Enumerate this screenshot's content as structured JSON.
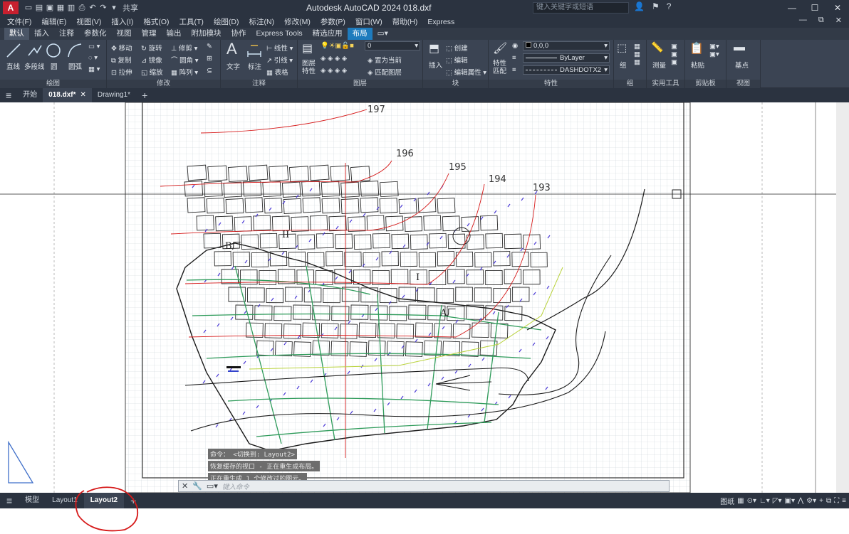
{
  "titlebar": {
    "logo": "A",
    "share": "共享",
    "app_title": "Autodesk AutoCAD 2024    018.dxf",
    "search_placeholder": "键入关键字或短语",
    "window_buttons": [
      "—",
      "☐",
      "✕"
    ]
  },
  "menubar": {
    "items": [
      "文件(F)",
      "编辑(E)",
      "视图(V)",
      "插入(I)",
      "格式(O)",
      "工具(T)",
      "绘图(D)",
      "标注(N)",
      "修改(M)",
      "参数(P)",
      "窗口(W)",
      "帮助(H)",
      "Express"
    ],
    "right_controls": [
      "—",
      "⧉",
      "✕"
    ]
  },
  "ribbon_tabs": {
    "items": [
      "默认",
      "插入",
      "注释",
      "参数化",
      "视图",
      "管理",
      "输出",
      "附加模块",
      "协作",
      "Express Tools",
      "精选应用",
      "布局"
    ],
    "active": "默认",
    "highlight": "布局"
  },
  "ribbon": {
    "draw": {
      "title": "绘图",
      "line": "直线",
      "polyline": "多段线",
      "circle": "圆",
      "arc": "圆弧"
    },
    "modify": {
      "title": "修改",
      "move": "移动",
      "rotate": "旋转",
      "trim": "修剪",
      "copy": "复制",
      "mirror": "镜像",
      "fillet": "圆角",
      "stretch": "拉伸",
      "scale": "缩放",
      "array": "阵列"
    },
    "annotation": {
      "title": "注释",
      "text": "文字",
      "dimension": "标注",
      "linear": "线性",
      "leader": "引线",
      "table": "表格"
    },
    "layers": {
      "title": "图层",
      "layer_props": "图层\n特性",
      "current_layer": "0",
      "set_current": "置为当前",
      "match_layer": "匹配图层"
    },
    "block": {
      "title": "块",
      "insert": "插入",
      "create": "创建",
      "edit": "编辑",
      "edit_attr": "编辑属性"
    },
    "properties": {
      "title": "特性",
      "match": "特性\n匹配",
      "color": "0,0,0",
      "lineweight": "ByLayer",
      "linetype": "DASHDOTX2"
    },
    "groups": {
      "title": "组",
      "group": "组"
    },
    "utilities": {
      "title": "实用工具",
      "measure": "测量"
    },
    "clipboard": {
      "title": "剪贴板",
      "paste": "粘贴"
    },
    "view": {
      "title": "视图",
      "base": "基点"
    }
  },
  "file_tabs": {
    "menu_icon": "≡",
    "items": [
      {
        "label": "开始",
        "active": false
      },
      {
        "label": "018.dxf*",
        "active": true
      },
      {
        "label": "Drawing1*",
        "active": false
      }
    ],
    "add": "+"
  },
  "drawing": {
    "contour_labels": [
      "197",
      "196",
      "195",
      "194",
      "193"
    ],
    "zone_labels": [
      "B厂",
      "II",
      "I",
      "A厂"
    ]
  },
  "command_history": [
    "命令：  <切换到: Layout2>",
    "恢复缓存的视口 - 正在重生成布局。",
    "正在重生成 1 个修改过的图元。"
  ],
  "command_line": {
    "placeholder": "键入命令"
  },
  "layout_tabs": {
    "items": [
      "模型",
      "Layout1",
      "Layout2"
    ],
    "active": "Layout2",
    "add": "+"
  },
  "statusbar": {
    "paper_label": "图纸"
  },
  "colors": {
    "titlebar": "#2b3340",
    "ribbon": "#3b4453",
    "accent": "#1e7bbd",
    "grid": "#c9d2d8",
    "annotation_red": "#d61a1a"
  }
}
